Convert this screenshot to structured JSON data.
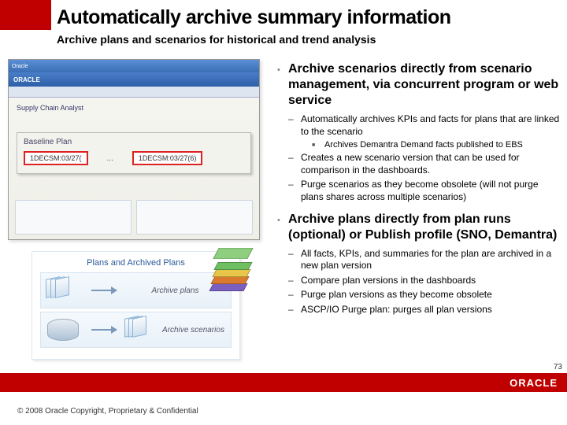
{
  "header": {
    "title": "Automatically archive summary information",
    "subtitle": "Archive plans and scenarios for historical and trend analysis"
  },
  "screenshot": {
    "window_title": "Oracle",
    "app_title": "ORACLE",
    "tab_label": "Supply Chain Analyst",
    "baseline_label": "Baseline Plan",
    "field1": "1DECSM:03/27(",
    "field2": "1DECSM:03/27(6)",
    "dots": "..."
  },
  "plans_box": {
    "title": "Plans and Archived Plans",
    "row1_caption": "Archive plans",
    "row2_caption": "Archive scenarios"
  },
  "bullets": [
    {
      "text": "Archive scenarios directly from scenario management, via concurrent program or web service",
      "subs": [
        {
          "text": "Automatically archives KPIs and facts for plans that are linked to the scenario",
          "subsubs": [
            {
              "text": "Archives Demantra Demand facts published to EBS"
            }
          ]
        },
        {
          "text": "Creates a new scenario version that can be used for comparison in the dashboards."
        },
        {
          "text": "Purge scenarios as they become obsolete (will not purge plans shares across multiple scenarios)"
        }
      ]
    },
    {
      "text": "Archive plans directly from plan runs (optional) or Publish profile (SNO, Demantra)",
      "subs": [
        {
          "text": "All facts, KPIs, and summaries for the plan are archived in a new plan version"
        },
        {
          "text": "Compare plan versions in the dashboards"
        },
        {
          "text": "Purge plan versions as they become obsolete"
        },
        {
          "text": "ASCP/IO Purge plan: purges all plan versions"
        }
      ]
    }
  ],
  "footer": {
    "logo": "ORACLE",
    "page": "73",
    "copyright": "© 2008 Oracle Copyright, Proprietary & Confidential"
  }
}
